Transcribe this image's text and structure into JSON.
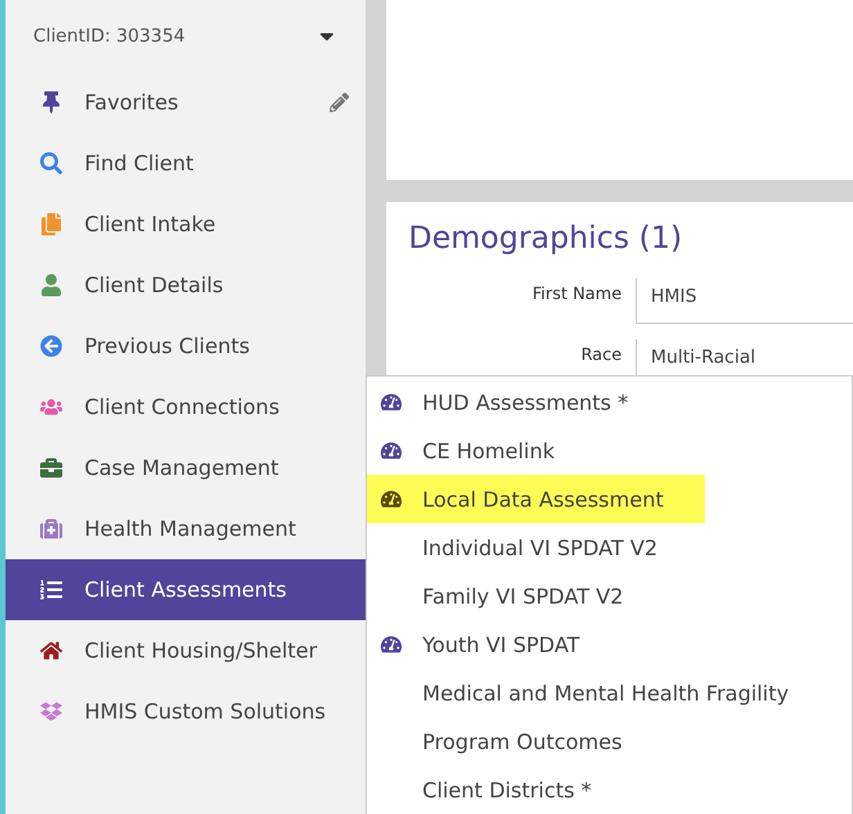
{
  "sidebar": {
    "client_id": "ClientID: 303354",
    "items": [
      {
        "label": "Favorites",
        "selected": false
      },
      {
        "label": "Find Client",
        "selected": false
      },
      {
        "label": "Client Intake",
        "selected": false
      },
      {
        "label": "Client Details",
        "selected": false
      },
      {
        "label": "Previous Clients",
        "selected": false
      },
      {
        "label": "Client Connections",
        "selected": false
      },
      {
        "label": "Case Management",
        "selected": false
      },
      {
        "label": "Health Management",
        "selected": false
      },
      {
        "label": "Client Assessments",
        "selected": true
      },
      {
        "label": "Client Housing/Shelter",
        "selected": false
      },
      {
        "label": "HMIS Custom Solutions",
        "selected": false
      }
    ]
  },
  "demographics": {
    "title": "Demographics (1)",
    "fields": [
      {
        "label": "First Name",
        "value": "HMIS"
      },
      {
        "label": "Race",
        "value": "Multi-Racial"
      }
    ]
  },
  "assessments_menu": [
    {
      "label": "HUD Assessments *",
      "has_icon": true,
      "highlighted": false
    },
    {
      "label": "CE Homelink",
      "has_icon": true,
      "highlighted": false
    },
    {
      "label": "Local Data Assessment",
      "has_icon": true,
      "highlighted": true
    },
    {
      "label": "Individual VI SPDAT V2",
      "has_icon": false,
      "highlighted": false
    },
    {
      "label": "Family VI SPDAT V2",
      "has_icon": false,
      "highlighted": false
    },
    {
      "label": "Youth VI SPDAT",
      "has_icon": true,
      "highlighted": false
    },
    {
      "label": "Medical and Mental Health Fragility",
      "has_icon": false,
      "highlighted": false
    },
    {
      "label": "Program Outcomes",
      "has_icon": false,
      "highlighted": false
    },
    {
      "label": "Client Districts *",
      "has_icon": false,
      "highlighted": false
    }
  ]
}
